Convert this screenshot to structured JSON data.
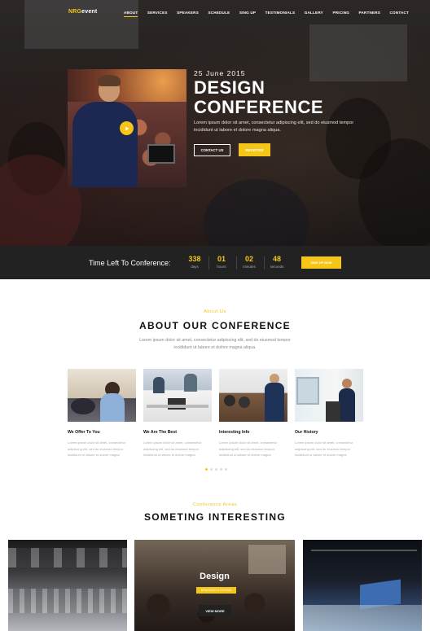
{
  "nav": {
    "logo_prefix": "NRG",
    "logo_suffix": "event",
    "items": [
      {
        "label": "ABOUT",
        "active": true
      },
      {
        "label": "SERVICES"
      },
      {
        "label": "SPEAKERS"
      },
      {
        "label": "SCHEDULE"
      },
      {
        "label": "SING UP"
      },
      {
        "label": "TESTIMONIALS"
      },
      {
        "label": "GALLERY"
      },
      {
        "label": "PRICING"
      },
      {
        "label": "PARTNERS"
      },
      {
        "label": "CONTACT"
      }
    ]
  },
  "hero": {
    "date": "25 June 2015",
    "title_line1": "DESIGN",
    "title_line2": "CONFERENCE",
    "description": "Lorem ipsum dolor sit amet, consectetur adipiscing elit, sed do eiusmod tempor incididunt ut labore et dolore magna aliqua.",
    "contact_label": "CONTACT US",
    "register_label": "REGISTER",
    "play_icon": "play-icon"
  },
  "countdown": {
    "label": "Time Left To Conference:",
    "units": [
      {
        "value": "338",
        "label": "days"
      },
      {
        "value": "01",
        "label": "hours"
      },
      {
        "value": "02",
        "label": "minutes"
      },
      {
        "value": "48",
        "label": "seconds"
      }
    ],
    "signup_label": "SING UP NOW"
  },
  "about": {
    "subtitle": "About Us",
    "title": "ABOUT OUR CONFERENCE",
    "description": "Lorem ipsum dolor sit amet, consectetur adipiscing elit, sed do eiusmod tempor incididunt ut labore et dolore magna aliqua.",
    "cards": [
      {
        "title": "We Offer To You",
        "text": "Lorem ipsum dolor sit amet, consectetur adipiscing elit, sed do eiusmod tempor incididunt ut labore et dolore magna"
      },
      {
        "title": "We Are The Best",
        "text": "Lorem ipsum dolor sit amet, consectetur adipiscing elit, sed do eiusmod tempor incididunt ut labore et dolore magna"
      },
      {
        "title": "Interesting Info",
        "text": "Lorem ipsum dolor sit amet, consectetur adipiscing elit, sed do eiusmod tempor incididunt ut labore et dolore magna"
      },
      {
        "title": "Our History",
        "text": "Lorem ipsum dolor sit amet, consectetur adipiscing elit, sed do eiusmod tempor incididunt ut labore et dolore magna"
      }
    ],
    "carousel_active": 0,
    "carousel_count": 5
  },
  "areas": {
    "subtitle": "Conference Areas",
    "title": "SOMETING INTERESTING",
    "center_title": "Design",
    "center_badge": "BRANDING & DESIGN",
    "center_button": "VIEW MORE"
  },
  "colors": {
    "accent": "#f5c518",
    "dark": "#222222"
  }
}
